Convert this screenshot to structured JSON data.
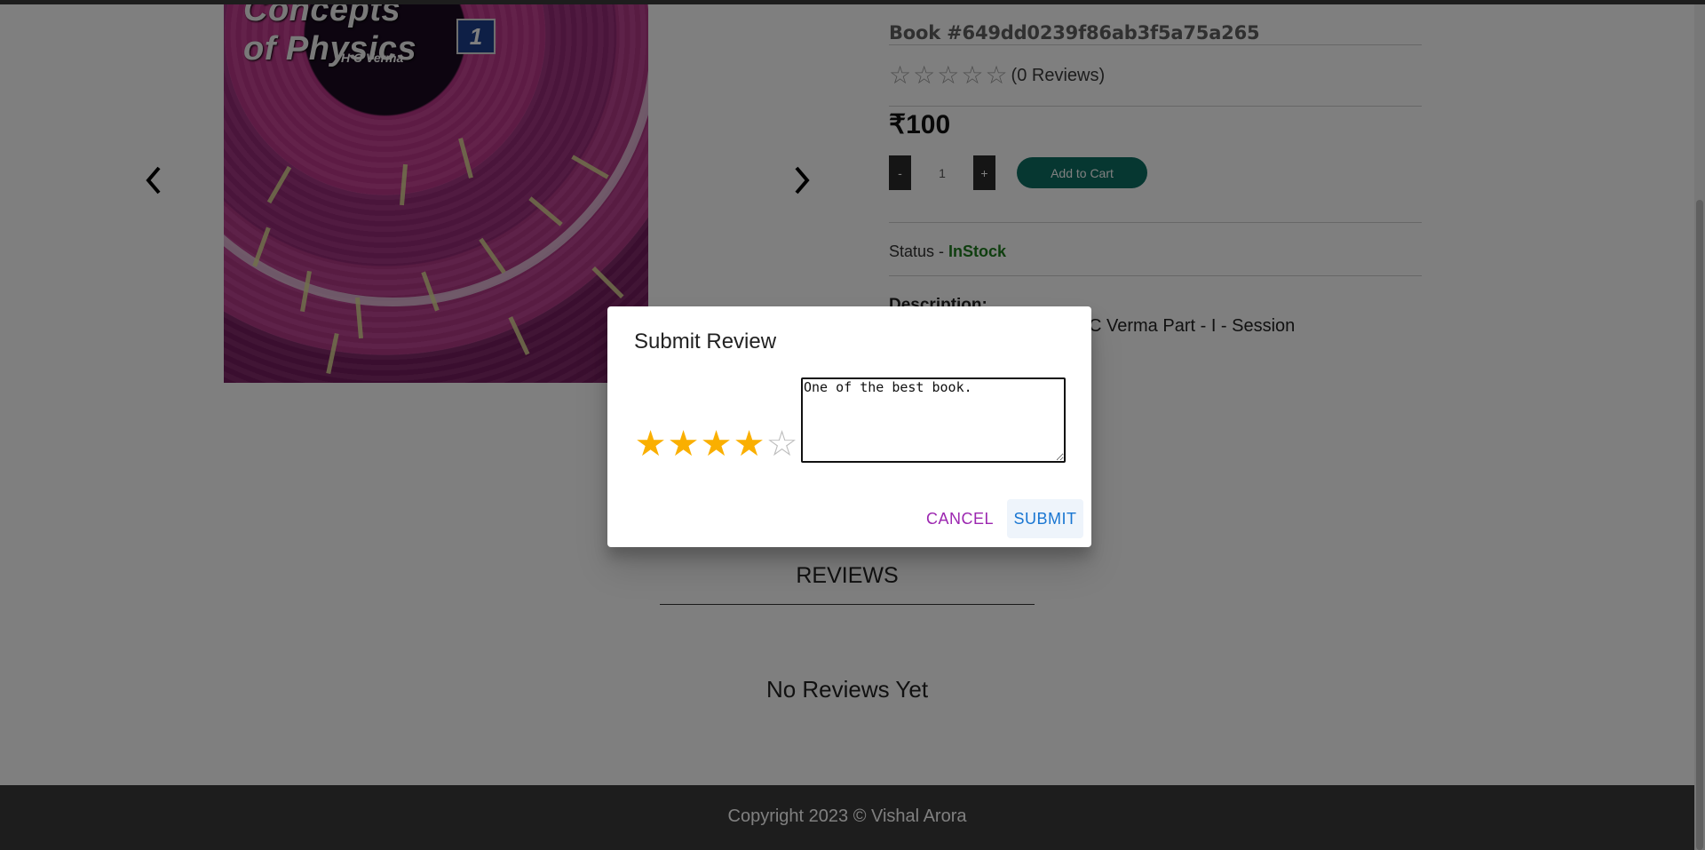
{
  "cover": {
    "title_line1": "Concepts",
    "title_line2": "of Physics",
    "author": "H C Verma",
    "volume": "1"
  },
  "product": {
    "book_id": "Book #649dd0239f86ab3f5a75a265",
    "rating_out_of_5": 0,
    "review_count": "(0 Reviews)",
    "price": "₹100",
    "qty_minus": "-",
    "quantity": "1",
    "qty_plus": "+",
    "add_to_cart": "Add to Cart",
    "status_label": "Status - ",
    "status_value": "InStock",
    "description_label": "Description:",
    "description_text": "C Verma Part - I - Session"
  },
  "reviews": {
    "title": "REVIEWS",
    "empty": "No Reviews Yet"
  },
  "footer": {
    "copyright": "Copyright 2023 © Vishal Arora"
  },
  "dialog": {
    "title": "Submit Review",
    "rating_value": 4,
    "rating_max": 5,
    "comment": "One of the best book.",
    "cancel": "CANCEL",
    "submit": "SUBMIT"
  },
  "colors": {
    "accent_cart": "#0d6e63",
    "status_green": "#1e7d1e",
    "star_filled": "#faaf00",
    "cancel_purple": "#9c27b0",
    "submit_blue": "#1976d2"
  }
}
